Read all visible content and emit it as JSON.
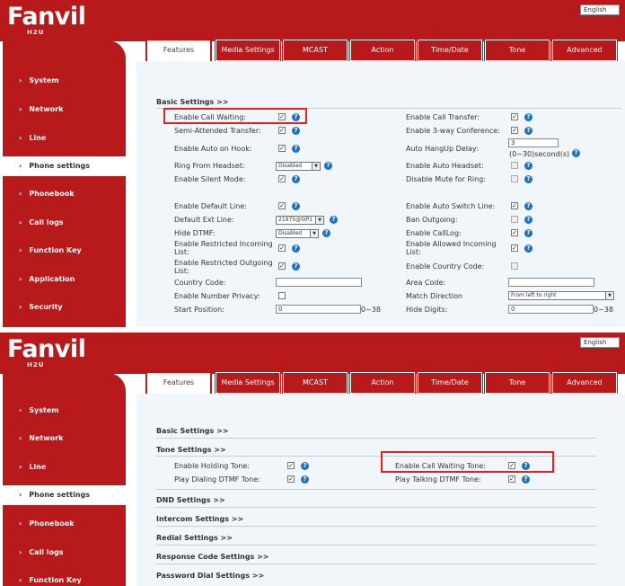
{
  "brand": {
    "logo": "Fanvil",
    "sub": "H2U",
    "language": "English"
  },
  "sidebar": {
    "items": [
      {
        "label": "System"
      },
      {
        "label": "Network"
      },
      {
        "label": "Line"
      },
      {
        "label": "Phone settings"
      },
      {
        "label": "Phonebook"
      },
      {
        "label": "Call logs"
      },
      {
        "label": "Function Key"
      },
      {
        "label": "Application"
      },
      {
        "label": "Security"
      }
    ],
    "arrow": "›"
  },
  "tabs": [
    "Features",
    "Media Settings",
    "MCAST",
    "Action",
    "Time/Date",
    "Tone",
    "Advanced"
  ],
  "panel1": {
    "section_title": "Basic Settings >>",
    "left": [
      {
        "label": "Enable Call Waiting:",
        "control": "checkbox",
        "checked": true
      },
      {
        "label": "Semi-Attended Transfer:",
        "control": "checkbox",
        "checked": true
      },
      {
        "label": "Enable Auto on Hook:",
        "control": "checkbox",
        "checked": true
      },
      {
        "label": "Ring From Headset:",
        "control": "select",
        "value": "Disabled"
      },
      {
        "label": "Enable Silent Mode:",
        "control": "checkbox",
        "checked": true
      },
      {
        "label": "Enable Default Line:",
        "control": "checkbox",
        "checked": true
      },
      {
        "label": "Default Ext Line:",
        "control": "select",
        "value": "21975@SIP1"
      },
      {
        "label": "Hide DTMF:",
        "control": "select",
        "value": "Disabled"
      },
      {
        "label": "Enable Restricted Incoming List:",
        "control": "checkbox",
        "checked": true
      },
      {
        "label": "Enable Restricted Outgoing List:",
        "control": "checkbox",
        "checked": true
      },
      {
        "label": "Country Code:",
        "control": "input",
        "value": ""
      },
      {
        "label": "Enable Number Privacy:",
        "control": "checkbox",
        "checked": false
      },
      {
        "label": "Start Position:",
        "control": "input",
        "value": "0",
        "hint": "0~38"
      }
    ],
    "right": [
      {
        "label": "Enable Call Transfer:",
        "control": "checkbox",
        "checked": true
      },
      {
        "label": "Enable 3-way Conference:",
        "control": "checkbox",
        "checked": true
      },
      {
        "label": "Auto HangUp Delay:",
        "control": "input",
        "value": "3",
        "hint": "(0~30)second(s)"
      },
      {
        "label": "Enable Auto Headset:",
        "control": "checkbox",
        "checked": false
      },
      {
        "label": "Disable Mute for Ring:",
        "control": "checkbox",
        "checked": false
      },
      {
        "label": "Enable Auto Switch Line:",
        "control": "checkbox",
        "checked": true
      },
      {
        "label": "Ban Outgoing:",
        "control": "checkbox",
        "checked": false
      },
      {
        "label": "Enable CallLog:",
        "control": "checkbox",
        "checked": true
      },
      {
        "label": "Enable Allowed Incoming List:",
        "control": "checkbox",
        "checked": true
      },
      {
        "label": "Enable Country Code:",
        "control": "checkbox",
        "checked": false
      },
      {
        "label": "Area Code:",
        "control": "input",
        "value": ""
      },
      {
        "label": "Match Direction",
        "control": "select",
        "value": "From left to right"
      },
      {
        "label": "Hide Digits:",
        "control": "input",
        "value": "0",
        "hint": "0~38"
      }
    ]
  },
  "panel2": {
    "sections": [
      "Basic Settings >>",
      "Tone Settings >>",
      "DND Settings >>",
      "Intercom Settings >>",
      "Redial Settings >>",
      "Response Code Settings >>",
      "Password Dial Settings >>"
    ],
    "tone_left": [
      {
        "label": "Enable Holding Tone:",
        "checked": true
      },
      {
        "label": "Play Dialing DTMF Tone:",
        "checked": true
      }
    ],
    "tone_right": [
      {
        "label": "Enable Call Waiting Tone:",
        "checked": true
      },
      {
        "label": "Play Talking DTMF Tone:",
        "checked": true
      }
    ]
  },
  "glyphs": {
    "check": "✓",
    "help": "?",
    "dropdown": "▼"
  },
  "colors": {
    "brand_red": "#b8191b",
    "highlight": "#e3211f",
    "help_blue": "#1f70c1"
  }
}
